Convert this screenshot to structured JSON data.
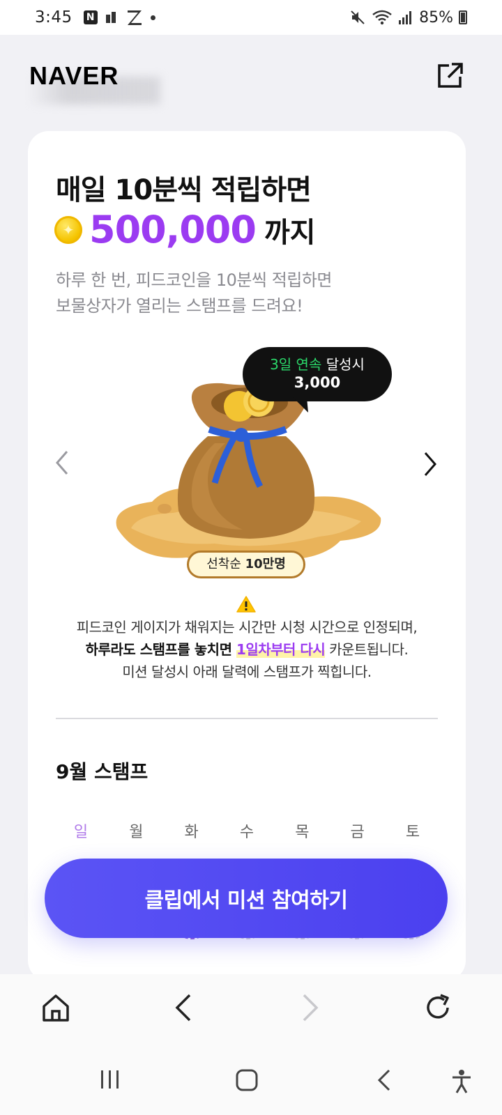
{
  "status_bar": {
    "time": "3:45",
    "app_icon_n": "N",
    "battery": "85%",
    "icons": [
      "mute-icon",
      "wifi-icon",
      "signal-icon",
      "battery-icon"
    ]
  },
  "header": {
    "logo": "NAVER",
    "share_icon": "external-link-icon"
  },
  "promo": {
    "headline": "매일 10분씩 적립하면",
    "amount": "500,000",
    "amount_suffix": "까지",
    "desc_line1": "하루 한 번, 피드코인을 10분씩 적립하면",
    "desc_line2": "보물상자가 열리는 스탬프를 드려요!"
  },
  "carousel": {
    "bubble_highlight": "3일 연속",
    "bubble_text": " 달성시",
    "bubble_amount": "3,000",
    "badge_prefix": "선착순 ",
    "badge_strong": "10만명"
  },
  "notice": {
    "line1": "피드코인 게이지가 채워지는 시간만 시청 시간으로 인정되며,",
    "line2_bold": "하루라도 스탬프를 놓치면 ",
    "line2_highlight": "1일차부터 다시",
    "line2_tail": " 카운트됩니다.",
    "line3": "미션 달성시 아래 달력에 스탬프가 찍힙니다."
  },
  "calendar": {
    "title": "9월 스탬프",
    "weekdays": [
      "일",
      "월",
      "화",
      "수",
      "목",
      "금",
      "토"
    ]
  },
  "cta": {
    "label": "클립에서 미션 참여하기"
  },
  "colors": {
    "accent_purple": "#9b3bf1",
    "cta_blue": "#5047f2",
    "green": "#2bd96a"
  }
}
